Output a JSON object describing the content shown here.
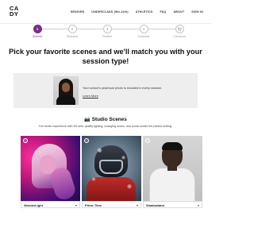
{
  "header": {
    "logo_line1": "CA",
    "logo_line2": "DY",
    "nav": [
      "SENIORS",
      "UNDERCLASS (9th-11th)",
      "ATHLETICS",
      "FAQ",
      "ABOUT",
      "SIGN IN"
    ]
  },
  "stepper": {
    "steps": [
      {
        "number": "1",
        "label": "Scenes",
        "active": true
      },
      {
        "number": "2",
        "label": "Sessions",
        "active": false
      },
      {
        "number": "3",
        "label": "Finalize",
        "active": false
      },
      {
        "number": "4",
        "label": "Schedule",
        "active": false
      },
      {
        "icon": "cart-icon",
        "label": "Checkout",
        "active": false
      }
    ],
    "accent_color": "#7b2d86"
  },
  "headline": "Pick your favorite scenes and we'll match you with your session type!",
  "info": {
    "text": "Your school's yearbook photo is included in every session.",
    "link": "Learn More"
  },
  "section": {
    "icon": "camera-icon",
    "title": "Studio Scenes",
    "description": "Full studio experience with 3D sets, quality lighting, changing rooms, and music create the perfect setting."
  },
  "cards": [
    {
      "name": "WonderLight"
    },
    {
      "name": "Prime Time"
    },
    {
      "name": "Shadowland"
    }
  ]
}
